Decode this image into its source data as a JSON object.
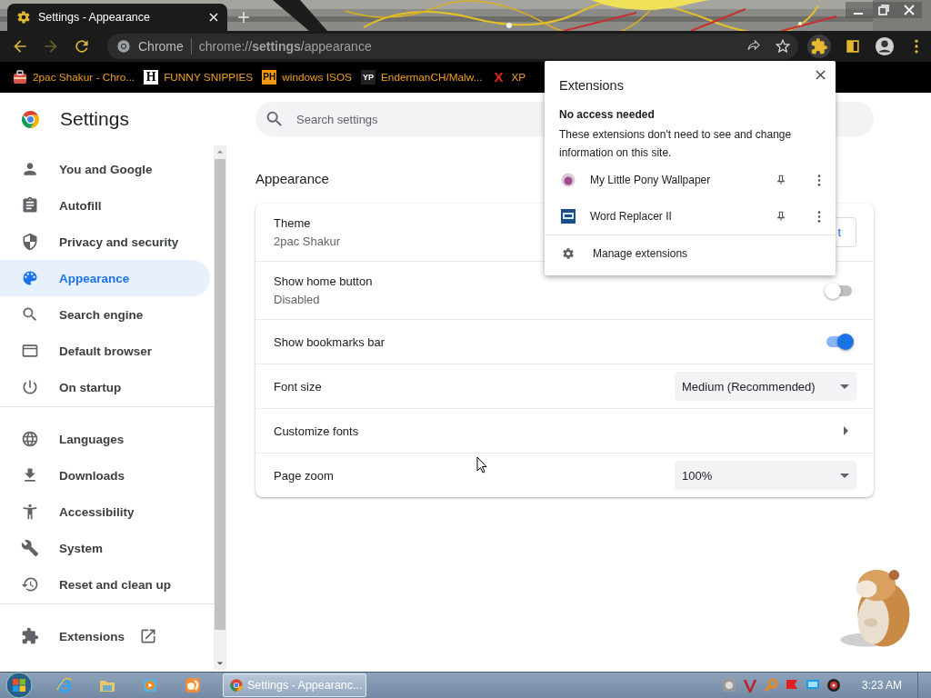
{
  "browser_tab": {
    "title": "Settings - Appearance"
  },
  "omnibox": {
    "chip": "Chrome",
    "url": "chrome://**settings**/appearance"
  },
  "bookmarks": [
    {
      "kind": "picture-icon",
      "label": "2pac Shakur - Chro..."
    },
    {
      "kind": "letter-white",
      "badge": "H",
      "label": "FUNNY SNIPPIES"
    },
    {
      "kind": "letter-orange",
      "badge": "PH",
      "label": "windows ISOS"
    },
    {
      "kind": "letter-dark",
      "badge": "YP",
      "label": "EndermanCH/Malw..."
    },
    {
      "kind": "letter-red",
      "badge": "X",
      "label": "XP"
    }
  ],
  "settings": {
    "title": "Settings",
    "search_placeholder": "Search settings"
  },
  "sidebar": {
    "sections": [
      {
        "items": [
          {
            "label": "You and Google",
            "selected": false
          },
          {
            "label": "Autofill",
            "selected": false
          },
          {
            "label": "Privacy and security",
            "selected": false
          },
          {
            "label": "Appearance",
            "selected": true
          },
          {
            "label": "Search engine",
            "selected": false
          },
          {
            "label": "Default browser",
            "selected": false
          },
          {
            "label": "On startup",
            "selected": false
          }
        ]
      },
      {
        "items": [
          {
            "label": "Languages",
            "selected": false
          },
          {
            "label": "Downloads",
            "selected": false
          },
          {
            "label": "Accessibility",
            "selected": false
          },
          {
            "label": "System",
            "selected": false
          },
          {
            "label": "Reset and clean up",
            "selected": false
          }
        ]
      },
      {
        "items": [
          {
            "label": "Extensions",
            "selected": false,
            "external": true
          }
        ]
      }
    ]
  },
  "appearance": {
    "heading": "Appearance",
    "rows": [
      {
        "kind": "theme",
        "label": "Theme",
        "value": "2pac Shakur",
        "button": "t"
      },
      {
        "kind": "toggle",
        "label": "Show home button",
        "value": "Disabled",
        "on": false
      },
      {
        "kind": "toggle",
        "label": "Show bookmarks bar",
        "on": true
      },
      {
        "kind": "select",
        "label": "Font size",
        "value": "Medium (Recommended)"
      },
      {
        "kind": "link",
        "label": "Customize fonts"
      },
      {
        "kind": "select",
        "label": "Page zoom",
        "value": "100%"
      }
    ]
  },
  "extensions_popup": {
    "title": "Extensions",
    "section_title": "No access needed",
    "description": "These extensions don't need to see and change information on this site.",
    "items": [
      {
        "kind": "round",
        "name": "My Little Pony Wallpaper"
      },
      {
        "kind": "tile",
        "name": "Word Replacer II"
      }
    ],
    "manage": "Manage extensions"
  },
  "taskbar": {
    "task": "Settings - Appearanc...",
    "clock": "3:23 AM"
  }
}
